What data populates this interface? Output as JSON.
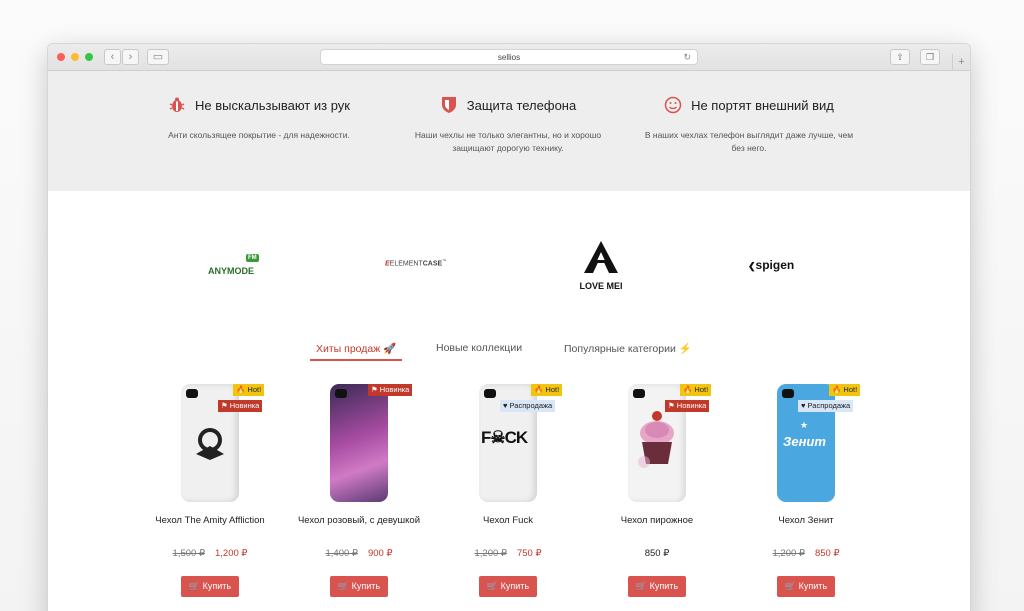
{
  "browser": {
    "url": "sellios"
  },
  "features": [
    {
      "icon": "bug-icon",
      "title": "Не выскальзывают из рук",
      "desc": "Анти скользящее покрытие - для надежности."
    },
    {
      "icon": "shield-icon",
      "title": "Защита телефона",
      "desc": "Наши чехлы не только элегантны, но и хорошо защищают дорогую технику."
    },
    {
      "icon": "smile-icon",
      "title": "Не портят внешний вид",
      "desc": "В наших чехлах телефон выглядит даже лучше, чем без него."
    }
  ],
  "brands": {
    "anymode": {
      "main": "ANYMODE",
      "badge": "FM"
    },
    "element": {
      "prefix": "ELEMENT",
      "suffix": "CASE"
    },
    "loveme": "LOVE MEI",
    "spigen": "spigen"
  },
  "tabs": [
    "Хиты продаж 🚀",
    "Новые коллекции",
    "Популярные категории ⚡"
  ],
  "products": [
    {
      "name": "Чехол The Amity Affliction",
      "old": "1,500 ₽",
      "price": "1,200 ₽",
      "badges": [
        "🔥 Hot!",
        "⚑ Новинка"
      ],
      "color": "#f2f2f2",
      "button": "🛒 Купить"
    },
    {
      "name": "Чехол розовый, с девушкой",
      "old": "1,400 ₽",
      "price": "900 ₽",
      "badges": [
        "⚑ Новинка"
      ],
      "color": "#a24a9a",
      "button": "🛒 Купить"
    },
    {
      "name": "Чехол Fuck",
      "old": "1,200 ₽",
      "price": "750 ₽",
      "badges": [
        "🔥 Hot!",
        "♥ Распродажа"
      ],
      "color": "#f2f2f2",
      "art": "F☠CK",
      "button": "🛒 Купить"
    },
    {
      "name": "Чехол пирожное",
      "old": "",
      "price": "850 ₽",
      "badges": [
        "🔥 Hot!",
        "⚑ Новинка"
      ],
      "color": "#f4f4f4",
      "button": "🛒 Купить"
    },
    {
      "name": "Чехол Зенит",
      "old": "1,200 ₽",
      "price": "850 ₽",
      "badges": [
        "🔥 Hot!",
        "♥ Распродажа"
      ],
      "color": "#4aa7df",
      "art": "Зенит",
      "button": "🛒 Купить"
    }
  ]
}
